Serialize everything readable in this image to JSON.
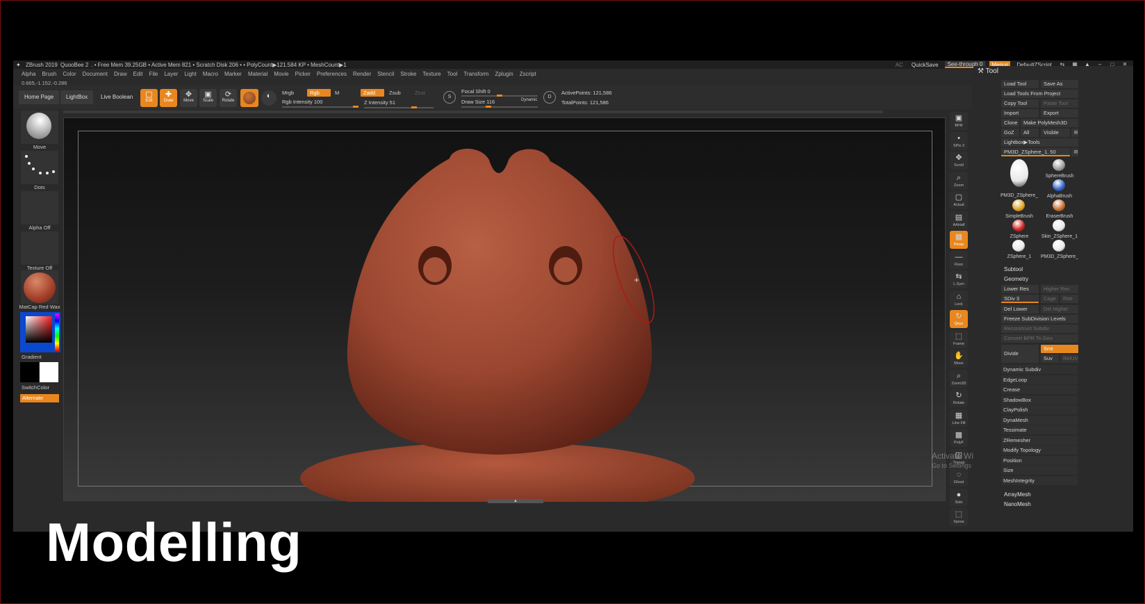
{
  "titlebar": {
    "app": "ZBrush 2019",
    "project": "QuooBee 2",
    "stats": ". • Free Mem 39.25GB • Active Mem 821 • Scratch Disk 206 • • PolyCount▶121.584 KP • MeshCount▶1",
    "ac": "AC",
    "quicksave": "QuickSave",
    "see_through": "See-through",
    "see_through_value": "0",
    "menus": "Menus",
    "default_script": "DefaultZScript"
  },
  "menubar": [
    "Alpha",
    "Brush",
    "Color",
    "Document",
    "Draw",
    "Edit",
    "File",
    "Layer",
    "Light",
    "Macro",
    "Marker",
    "Material",
    "Movie",
    "Picker",
    "Preferences",
    "Render",
    "Stencil",
    "Stroke",
    "Texture",
    "Tool",
    "Transform",
    "Zplugin",
    "Zscript"
  ],
  "coords": "0.665,-1.152,-0.286",
  "shelf": {
    "home": "Home Page",
    "lightbox": "LightBox",
    "live_boolean": "Live Boolean",
    "edit": "Edit",
    "draw": "Draw",
    "move": "Move",
    "scale": "Scale",
    "rotate": "Rotate",
    "mrgb": "Mrgb",
    "rgb": "Rgb",
    "m": "M",
    "zadd": "Zadd",
    "zsub": "Zsub",
    "zcut": "Zcut",
    "rgb_intensity": "Rgb Intensity 100",
    "z_intensity": "Z Intensity 51",
    "focal_shift": "Focal Shift 0",
    "draw_size": "Draw Size 116",
    "dynamic": "Dynamic",
    "active_points": "ActivePoints: 121,586",
    "total_points": "TotalPoints: 121,586"
  },
  "left": {
    "brush": "Move",
    "stroke": "Dots",
    "alpha": "Alpha Off",
    "texture": "Texture Off",
    "material": "MatCap Red Wax",
    "gradient": "Gradient",
    "switch_color": "SwitchColor",
    "alternate": "Alternate"
  },
  "right_strip": [
    "BPR",
    "SPix 3",
    "Scroll",
    "Zoom",
    "Actual",
    "AAHalf",
    "Persp",
    "Floor",
    "L.Sym",
    "Lock",
    "Qxyz",
    "Frame",
    "Move",
    "Zoom3D",
    "Rotate",
    "Line Fill",
    "PolyF",
    "Transp",
    "Ghost",
    "Solo",
    "Xpose"
  ],
  "panel": {
    "title": "Tool",
    "load_tool": "Load Tool",
    "save_as": "Save As",
    "load_from_project": "Load Tools From Project",
    "copy_tool": "Copy Tool",
    "paste_tool": "Paste Tool",
    "import": "Import",
    "export": "Export",
    "clone": "Clone",
    "make_polymesh": "Make PolyMesh3D",
    "goz": "GoZ",
    "all": "All",
    "visible": "Visible",
    "r": "R",
    "lightbox_tools": "Lightbox▶Tools",
    "current_tool": "PM3D_ZSphere_1. 50",
    "tools": [
      {
        "name": "PM3D_ZSphere_",
        "color": "#e8e8e8"
      },
      {
        "name": "SphereBrush",
        "color": "#9a9a9a"
      },
      {
        "name": "AlphaBrush",
        "color": "#2f5fc8"
      },
      {
        "name": "SimpleBrush",
        "color": "#e0a020"
      },
      {
        "name": "EraserBrush",
        "color": "#c86a2a"
      },
      {
        "name": "ZSphere",
        "color": "#d02020"
      },
      {
        "name": "Skin_ZSphere_1",
        "color": "#e8e8e8"
      },
      {
        "name": "ZSphere_1",
        "color": "#e8e8e8"
      },
      {
        "name": "PM3D_ZSphere_",
        "color": "#e8e8e8"
      }
    ],
    "subtool": "Subtool",
    "geometry": "Geometry",
    "lower_res": "Lower Res",
    "higher_res": "Higher Res",
    "sdiv": "SDiv 3",
    "cage": "Cage",
    "rstr": "Rstr",
    "del_lower": "Del Lower",
    "del_higher": "Del Higher",
    "freeze": "Freeze SubDivision Levels",
    "reconstruct": "Reconstruct Subdiv",
    "convert_bpr": "Convert BPR To Geo",
    "divide": "Divide",
    "smt": "Smt",
    "suv": "Suv",
    "reluv": "RelUV",
    "items": [
      "Dynamic Subdiv",
      "EdgeLoop",
      "Crease",
      "ShadowBox",
      "ClayPolish",
      "DynaMesh",
      "Tessimate",
      "ZRemesher",
      "Modify Topology",
      "Position",
      "Size",
      "MeshIntegrity"
    ],
    "array_mesh": "ArrayMesh",
    "nano_mesh": "NanoMesh"
  },
  "watermark": {
    "line1": "Activate Windows",
    "line2": "Go to Settings to activate Windows."
  },
  "caption": "Modelling",
  "colors": {
    "accent": "#e8871f",
    "model": "#a8513a"
  }
}
